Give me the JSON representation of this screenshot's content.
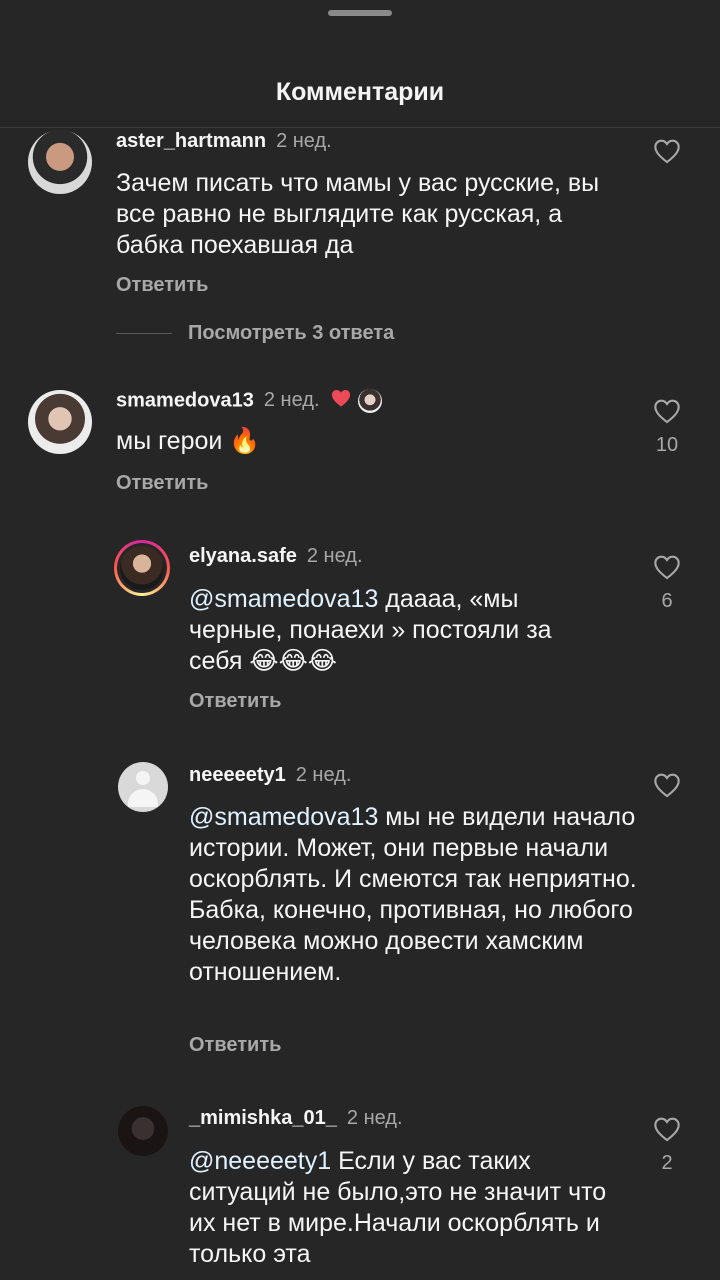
{
  "header": {
    "title": "Комментарии"
  },
  "comments": [
    {
      "username": "aster_hartmann",
      "time": "2 нед.",
      "text": "Зачем писать что мамы у вас русские, вы все равно не выглядите как русская, а бабка поехавшая да",
      "reply_label": "Ответить",
      "view_replies": "Посмотреть 3 ответа",
      "likes": ""
    },
    {
      "username": "smamedova13",
      "time": "2 нед.",
      "text": "мы герои 🔥",
      "reply_label": "Ответить",
      "likes": "10"
    },
    {
      "username": "elyana.safe",
      "time": "2 нед.",
      "mention": "@smamedova13",
      "text": " даааа, «мы черные, понаехи » постояли за себя 😂😂😂",
      "reply_label": "Ответить",
      "likes": "6"
    },
    {
      "username": "neeeeety1",
      "time": "2 нед.",
      "mention": "@smamedova13",
      "text": " мы не видели начало истории. Может, они первые начали оскорблять. И смеются так неприятно. Бабка, конечно, противная, но любого человека можно довести хамским отношением.",
      "reply_label": "Ответить",
      "likes": ""
    },
    {
      "username": "_mimishka_01_",
      "time": "2 нед.",
      "mention": "@neeeeety1",
      "text": " Если у вас таких ситуаций не было,это не значит что их нет в мире.Начали оскорблять и только эта",
      "likes": "2"
    }
  ],
  "icons": {
    "like": "heart-outline-icon",
    "creator_like": "heart-filled-icon"
  },
  "colors": {
    "background": "#262626",
    "secondary_text": "#a8a8a8",
    "creator_heart": "#ed4956"
  }
}
